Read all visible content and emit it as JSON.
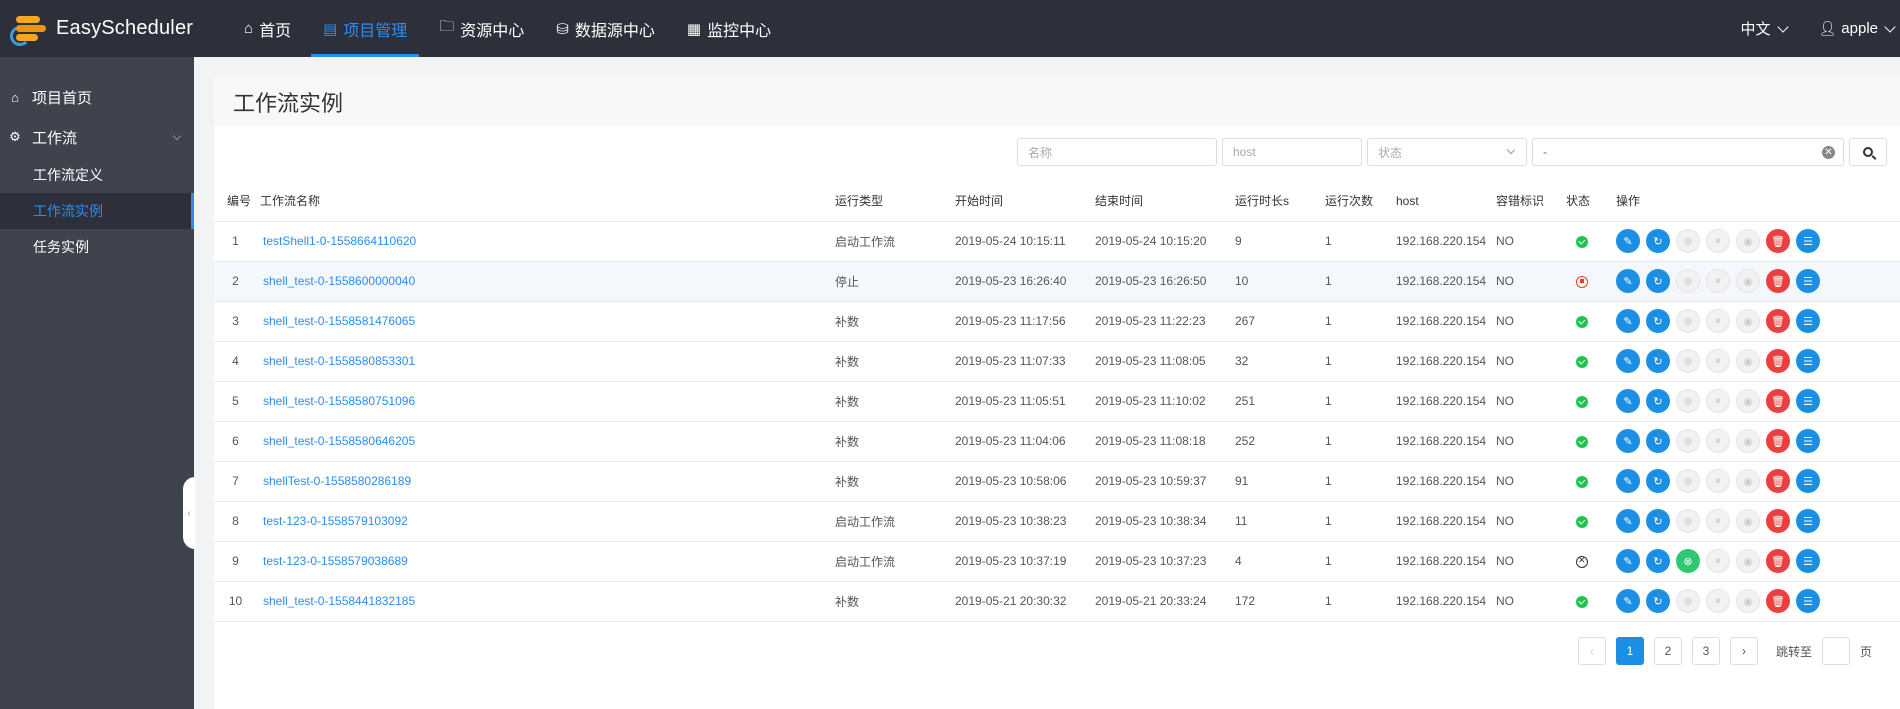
{
  "app": {
    "name": "EasyScheduler"
  },
  "nav": [
    {
      "label": "首页",
      "icon": "home-icon",
      "active": false
    },
    {
      "label": "项目管理",
      "icon": "project-icon",
      "active": true
    },
    {
      "label": "资源中心",
      "icon": "folder-icon",
      "active": false
    },
    {
      "label": "数据源中心",
      "icon": "database-icon",
      "active": false
    },
    {
      "label": "监控中心",
      "icon": "monitor-icon",
      "active": false
    }
  ],
  "top_right": {
    "language": "中文",
    "user": "apple"
  },
  "sidebar": {
    "project_home": "项目首页",
    "workflow": "工作流",
    "items": [
      "工作流定义",
      "工作流实例",
      "任务实例"
    ],
    "active_index": 1
  },
  "page": {
    "title": "工作流实例"
  },
  "filters": {
    "name_placeholder": "名称",
    "host_placeholder": "host",
    "state_placeholder": "状态",
    "date_value": "-"
  },
  "table": {
    "headers": [
      "编号",
      "工作流名称",
      "运行类型",
      "开始时间",
      "结束时间",
      "运行时长s",
      "运行次数",
      "host",
      "容错标识",
      "状态",
      "操作"
    ],
    "rows": [
      {
        "id": "1",
        "name": "testShell1-0-1558664110620",
        "type": "启动工作流",
        "start": "2019-05-24 10:15:11",
        "end": "2019-05-24 10:15:20",
        "duration": "9",
        "times": "1",
        "host": "192.168.220.154",
        "fault": "NO",
        "state": "success"
      },
      {
        "id": "2",
        "name": "shell_test-0-1558600000040",
        "type": "停止",
        "start": "2019-05-23 16:26:40",
        "end": "2019-05-23 16:26:50",
        "duration": "10",
        "times": "1",
        "host": "192.168.220.154",
        "fault": "NO",
        "state": "stop"
      },
      {
        "id": "3",
        "name": "shell_test-0-1558581476065",
        "type": "补数",
        "start": "2019-05-23 11:17:56",
        "end": "2019-05-23 11:22:23",
        "duration": "267",
        "times": "1",
        "host": "192.168.220.154",
        "fault": "NO",
        "state": "success"
      },
      {
        "id": "4",
        "name": "shell_test-0-1558580853301",
        "type": "补数",
        "start": "2019-05-23 11:07:33",
        "end": "2019-05-23 11:08:05",
        "duration": "32",
        "times": "1",
        "host": "192.168.220.154",
        "fault": "NO",
        "state": "success"
      },
      {
        "id": "5",
        "name": "shell_test-0-1558580751096",
        "type": "补数",
        "start": "2019-05-23 11:05:51",
        "end": "2019-05-23 11:10:02",
        "duration": "251",
        "times": "1",
        "host": "192.168.220.154",
        "fault": "NO",
        "state": "success"
      },
      {
        "id": "6",
        "name": "shell_test-0-1558580646205",
        "type": "补数",
        "start": "2019-05-23 11:04:06",
        "end": "2019-05-23 11:08:18",
        "duration": "252",
        "times": "1",
        "host": "192.168.220.154",
        "fault": "NO",
        "state": "success"
      },
      {
        "id": "7",
        "name": "shellTest-0-1558580286189",
        "type": "补数",
        "start": "2019-05-23 10:58:06",
        "end": "2019-05-23 10:59:37",
        "duration": "91",
        "times": "1",
        "host": "192.168.220.154",
        "fault": "NO",
        "state": "success"
      },
      {
        "id": "8",
        "name": "test-123-0-1558579103092",
        "type": "启动工作流",
        "start": "2019-05-23 10:38:23",
        "end": "2019-05-23 10:38:34",
        "duration": "11",
        "times": "1",
        "host": "192.168.220.154",
        "fault": "NO",
        "state": "success"
      },
      {
        "id": "9",
        "name": "test-123-0-1558579038689",
        "type": "启动工作流",
        "start": "2019-05-23 10:37:19",
        "end": "2019-05-23 10:37:23",
        "duration": "4",
        "times": "1",
        "host": "192.168.220.154",
        "fault": "NO",
        "state": "failure"
      },
      {
        "id": "10",
        "name": "shell_test-0-1558441832185",
        "type": "补数",
        "start": "2019-05-21 20:30:32",
        "end": "2019-05-21 20:33:24",
        "duration": "172",
        "times": "1",
        "host": "192.168.220.154",
        "fault": "NO",
        "state": "success"
      }
    ]
  },
  "pagination": {
    "pages": [
      "1",
      "2",
      "3"
    ],
    "current": "1",
    "jump_label": "跳转至",
    "page_suffix": "页"
  },
  "colors": {
    "accent": "#1a8fe3",
    "topbar": "#2d303b",
    "sidebar": "#3e434e",
    "success": "#1ec44d",
    "danger": "#ed3f3f"
  }
}
